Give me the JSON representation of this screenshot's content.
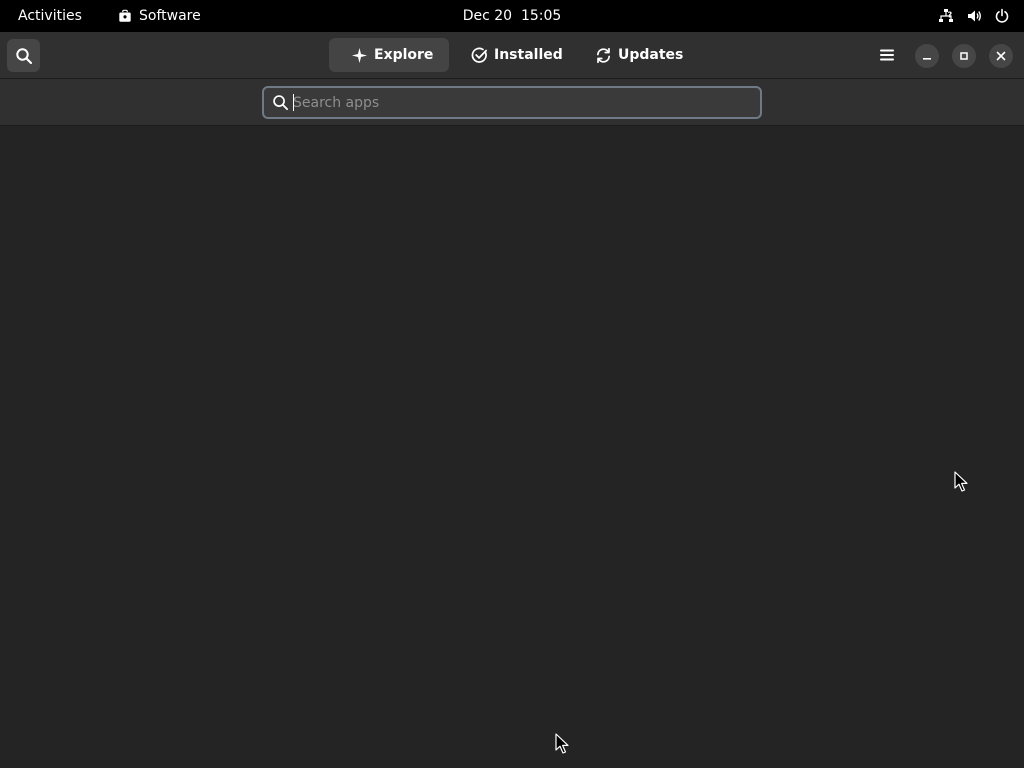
{
  "topbar": {
    "activities_label": "Activities",
    "app_name": "Software",
    "app_icon": "software-bag-icon",
    "clock": "Dec 20  15:05",
    "status_icons": [
      "network-unknown-icon",
      "volume-icon",
      "power-icon"
    ]
  },
  "headerbar": {
    "search_button_icon": "search-icon",
    "tabs": [
      {
        "label": "Explore",
        "icon": "sparkle-icon",
        "active": true
      },
      {
        "label": "Installed",
        "icon": "check-circle-icon",
        "active": false
      },
      {
        "label": "Updates",
        "icon": "refresh-icon",
        "active": false
      }
    ],
    "menu_icon": "hamburger-menu-icon",
    "window_controls": [
      "minimize-icon",
      "maximize-icon",
      "close-icon"
    ]
  },
  "search": {
    "placeholder": "Search apps",
    "value": ""
  },
  "colors": {
    "topbar_bg": "#000000",
    "headerbar_bg": "#303030",
    "content_bg": "#242424",
    "active_tab_bg": "#444444",
    "search_border": "#707a87"
  }
}
